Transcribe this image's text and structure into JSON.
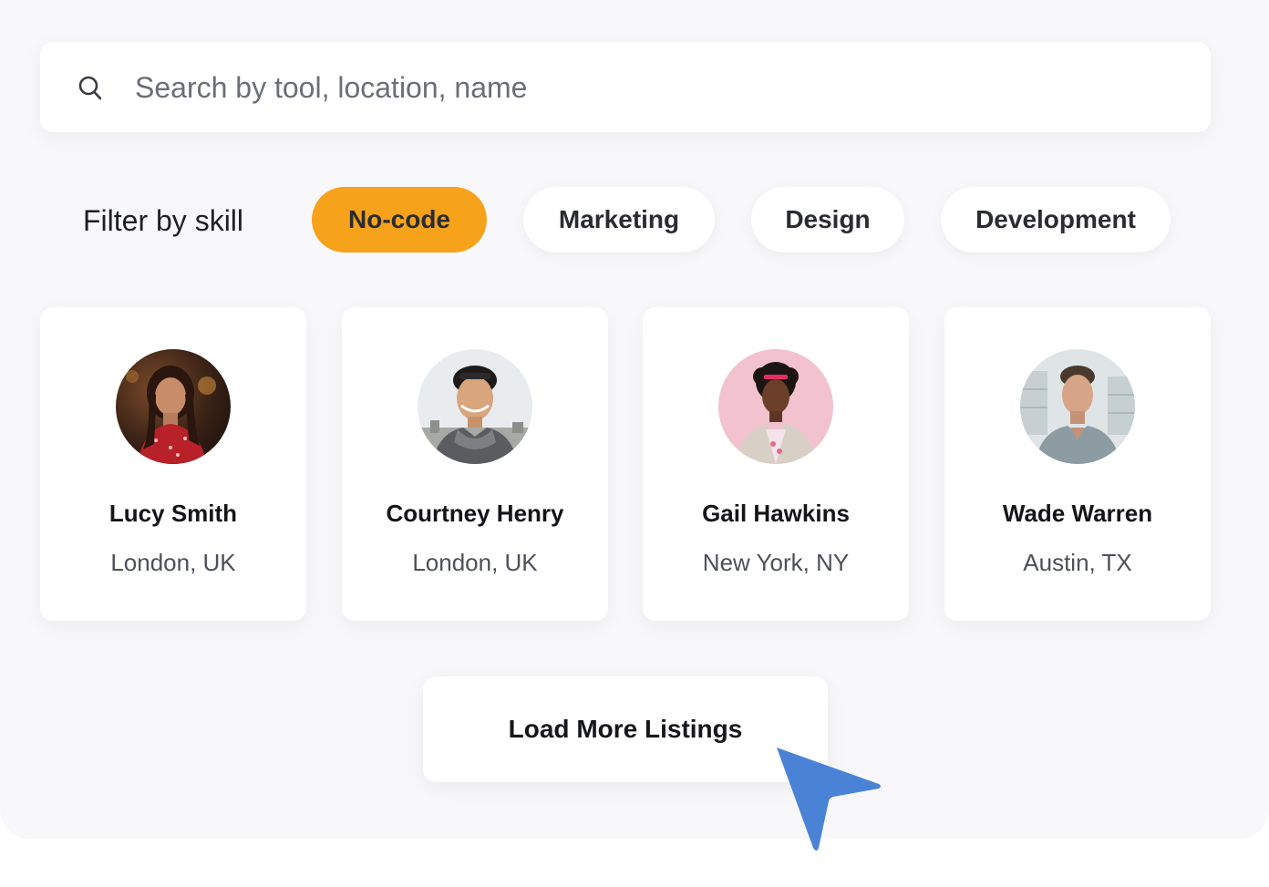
{
  "search": {
    "placeholder": "Search by tool, location, name",
    "icon": "search-icon"
  },
  "filter": {
    "label": "Filter by skill",
    "chips": [
      {
        "label": "No-code",
        "active": true
      },
      {
        "label": "Marketing",
        "active": false
      },
      {
        "label": "Design",
        "active": false
      },
      {
        "label": "Development",
        "active": false
      }
    ]
  },
  "listings": [
    {
      "name": "Lucy Smith",
      "location": "London, UK"
    },
    {
      "name": "Courtney Henry",
      "location": "London, UK"
    },
    {
      "name": "Gail Hawkins",
      "location": "New York, NY"
    },
    {
      "name": "Wade Warren",
      "location": "Austin, TX"
    }
  ],
  "load_more": {
    "label": "Load More Listings"
  },
  "colors": {
    "accent": "#f7a21b",
    "cursor": "#4a83d6",
    "background": "#f8f8fa",
    "card": "#ffffff"
  },
  "cursor_icon": "pointer-arrow-icon"
}
